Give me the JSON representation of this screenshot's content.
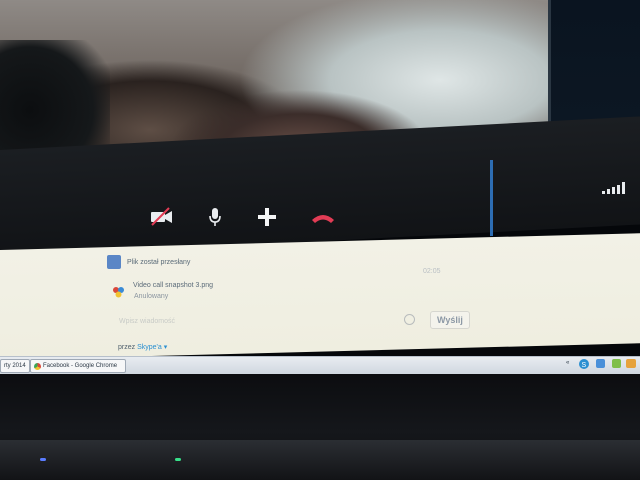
{
  "call": {
    "controls": {
      "video": "video-off-icon",
      "mic": "microphone-icon",
      "add": "plus-icon",
      "hangup": "hang-up-icon"
    },
    "signal": "signal-strength-icon"
  },
  "chat": {
    "messages": [
      {
        "text": "Plik został przesłany",
        "time": "02:05"
      },
      {
        "file": "Video call snapshot 3.png",
        "status": "Anulowany"
      }
    ],
    "input_placeholder": "Wpisz wiadomość",
    "send_label": "Wyślij",
    "via_prefix": "przez ",
    "via_service": "Skype'a"
  },
  "taskbar": {
    "left_item": "rty 2014",
    "chrome_item": "Facebook - Google Chrome",
    "tray_expand": "«"
  },
  "colors": {
    "hangup": "#e23c55",
    "accent": "#2d6db3",
    "link": "#2a8fd1"
  }
}
